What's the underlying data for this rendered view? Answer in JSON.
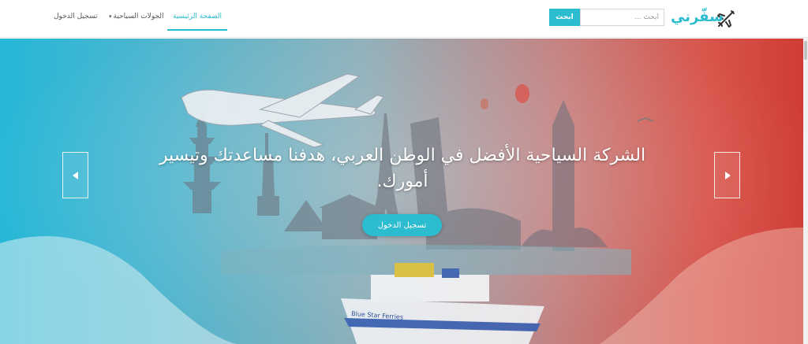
{
  "brand": {
    "name": "سفّرني",
    "logo_icon": "airplane-icon",
    "accent_color": "#2bbcd0"
  },
  "search": {
    "placeholder": "أبحث ...",
    "button_label": "ابحث"
  },
  "nav": {
    "home": "الصفحة الرئيسية",
    "tours": "الجولات السياحية",
    "login": "تسجيل الدخول"
  },
  "hero": {
    "headline": "الشركة السياحية الأفضل في الوطن العربي، هدفنا مساعدتك وتيسير أمورك.",
    "cta_label": "تسجيل الدخول",
    "prev_icon": "chevron-left-icon",
    "next_icon": "chevron-right-icon",
    "ship_text": "Blue Star Ferries"
  }
}
